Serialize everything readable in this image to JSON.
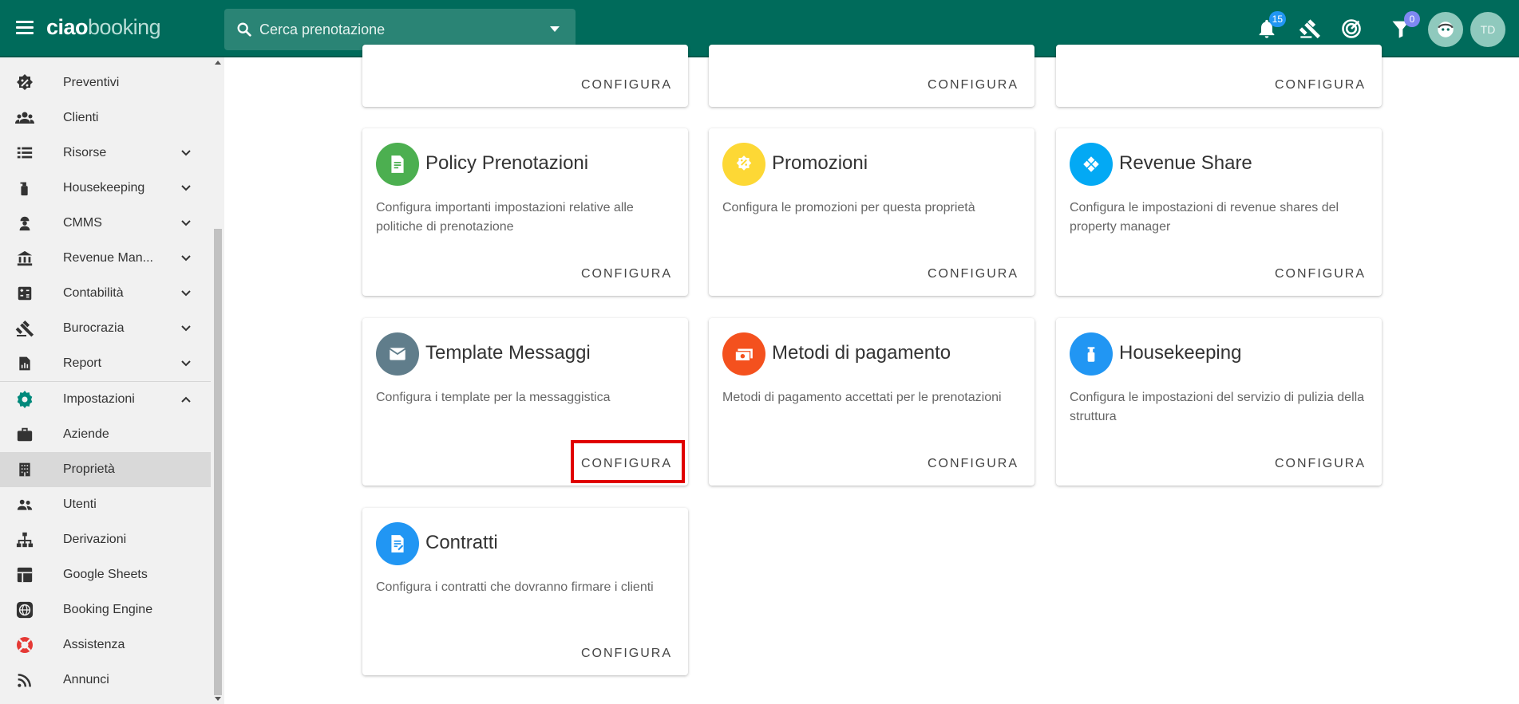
{
  "header": {
    "logo_bold": "ciao",
    "logo_light": "booking",
    "search_placeholder": "Cerca prenotazione",
    "notifications_count": "15",
    "filter_count": "0",
    "user_initials": "TD"
  },
  "sidebar": {
    "items": [
      {
        "label": "Preventivi",
        "icon": "percent-badge-icon",
        "expandable": false
      },
      {
        "label": "Clienti",
        "icon": "users-icon",
        "expandable": false
      },
      {
        "label": "Risorse",
        "icon": "list-icon",
        "expandable": true
      },
      {
        "label": "Housekeeping",
        "icon": "spray-bottle-icon",
        "expandable": true
      },
      {
        "label": "CMMS",
        "icon": "worker-icon",
        "expandable": true
      },
      {
        "label": "Revenue Man...",
        "icon": "bank-icon",
        "expandable": true
      },
      {
        "label": "Contabilità",
        "icon": "calculator-icon",
        "expandable": true
      },
      {
        "label": "Burocrazia",
        "icon": "gavel-icon",
        "expandable": true
      },
      {
        "label": "Report",
        "icon": "report-icon",
        "expandable": true
      },
      {
        "label": "Impostazioni",
        "icon": "gear-icon",
        "expandable": true,
        "expanded": true
      },
      {
        "label": "Aziende",
        "icon": "briefcase-icon",
        "expandable": false
      },
      {
        "label": "Proprietà",
        "icon": "building-icon",
        "expandable": false,
        "active": true
      },
      {
        "label": "Utenti",
        "icon": "people-icon",
        "expandable": false
      },
      {
        "label": "Derivazioni",
        "icon": "sitemap-icon",
        "expandable": false
      },
      {
        "label": "Google Sheets",
        "icon": "sheet-icon",
        "expandable": false
      },
      {
        "label": "Booking Engine",
        "icon": "globe-icon",
        "expandable": false
      },
      {
        "label": "Assistenza",
        "icon": "lifebuoy-icon",
        "expandable": false
      },
      {
        "label": "Annunci",
        "icon": "rss-icon",
        "expandable": false
      }
    ]
  },
  "cards": {
    "button_label": "CONFIGURA",
    "items": [
      {
        "title": "",
        "description": "",
        "color": "#ffffff"
      },
      {
        "title": "",
        "description": "",
        "color": "#ffffff"
      },
      {
        "title": "",
        "description": "",
        "color": "#ffffff"
      },
      {
        "title": "Policy Prenotazioni",
        "description": "Configura importanti impostazioni relative alle politiche di prenotazione",
        "color": "#4caf50",
        "icon": "policy-doc-icon"
      },
      {
        "title": "Promozioni",
        "description": "Configura le promozioni per questa proprietà",
        "color": "#fdd835",
        "icon": "promo-badge-icon"
      },
      {
        "title": "Revenue Share",
        "description": "Configura le impostazioni di revenue shares del property manager",
        "color": "#03a9f4",
        "icon": "diamond-share-icon"
      },
      {
        "title": "Template Messaggi",
        "description": "Configura i template per la messaggistica",
        "color": "#607d8b",
        "icon": "envelope-icon"
      },
      {
        "title": "Metodi di pagamento",
        "description": "Metodi di pagamento accettati per le prenotazioni",
        "color": "#f4511e",
        "icon": "cash-icon"
      },
      {
        "title": "Housekeeping",
        "description": "Configura le impostazioni del servizio di pulizia della struttura",
        "color": "#2196f3",
        "icon": "spray-bottle-icon"
      },
      {
        "title": "Contratti",
        "description": "Configura i contratti che dovranno firmare i clienti",
        "color": "#2196f3",
        "icon": "contract-icon"
      }
    ]
  }
}
